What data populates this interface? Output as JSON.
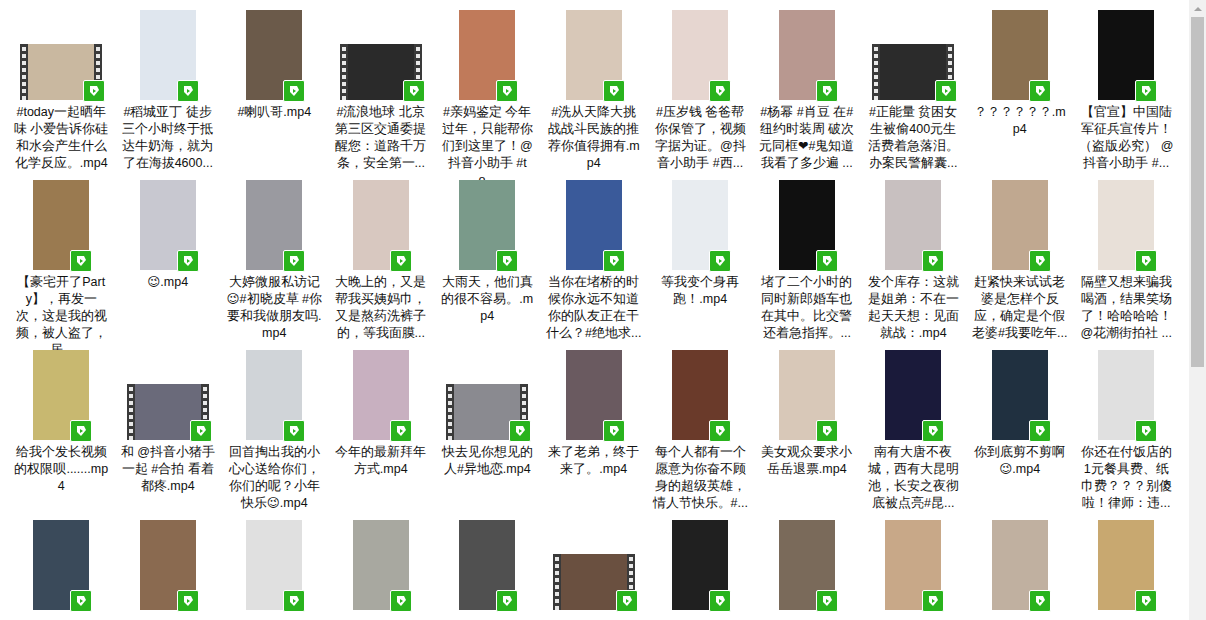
{
  "files": [
    {
      "caption": "#today一起晒年味  小爱告诉你硅和水会产生什么化学反应。.mp4",
      "kind": "film",
      "color": "#c9b8a0"
    },
    {
      "caption": "#稻城亚丁 徒步三个小时终于抵达牛奶海，就为了在海拔4600...",
      "kind": "portrait",
      "color": "#dfe6ee"
    },
    {
      "caption": "#喇叭哥.mp4",
      "kind": "portrait",
      "color": "#6b5a4a"
    },
    {
      "caption": "#流浪地球 北京第三区交通委提醒您：道路千万条，安全第一...",
      "kind": "film",
      "color": "#2a2a2a"
    },
    {
      "caption": "#亲妈鉴定 今年过年，只能帮你们到这里了！@抖音小助手 #to...",
      "kind": "portrait",
      "color": "#c07a5a"
    },
    {
      "caption": "#洗从天降大挑战战斗民族的推荐你值得拥有.mp4",
      "kind": "portrait",
      "color": "#d8c8b8"
    },
    {
      "caption": "#压岁钱 爸爸帮你保管了，视频字据为证。@抖音小助手 #西...",
      "kind": "portrait",
      "color": "#e6d6d0"
    },
    {
      "caption": "#杨幂 #肖豆 在#纽约时装周 破次元同框❤#鬼知道我看了多少遍 ...",
      "kind": "portrait",
      "color": "#b89890"
    },
    {
      "caption": "#正能量 贫困女生被偷400元生活费着急落泪。办案民警解囊...",
      "kind": "film",
      "color": "#2b2b2b"
    },
    {
      "caption": "？？？？？？.mp4",
      "kind": "portrait",
      "color": "#8a7050"
    },
    {
      "caption": "【官宣】中国陆军征兵宣传片！（盗版必究） @抖音小助手 #...",
      "kind": "portrait",
      "color": "#101010"
    },
    {
      "caption": "【豪宅开了Party】，再发一次，这是我的视频，被人盗了，居...",
      "kind": "portrait",
      "color": "#9a7a50"
    },
    {
      "caption": "😉.mp4",
      "kind": "portrait",
      "color": "#c8c8d0"
    },
    {
      "caption": "大婷微服私访记😉#初晓皮草 #你要和我做朋友吗.mp4",
      "kind": "portrait",
      "color": "#9a9aa0"
    },
    {
      "caption": "大晚上的，又是帮我买姨妈巾，又是熬药洗裤子的，等我面膜...",
      "kind": "portrait",
      "color": "#d8c8c0"
    },
    {
      "caption": "大雨天，他们真的很不容易。.mp4",
      "kind": "portrait",
      "color": "#7a9a8a"
    },
    {
      "caption": "当你在堵桥的时候你永远不知道你的队友正在干什么？#绝地求...",
      "kind": "portrait",
      "color": "#3a5a9a"
    },
    {
      "caption": "等我变个身再跑！.mp4",
      "kind": "portrait",
      "color": "#e8ecf0"
    },
    {
      "caption": "堵了二个小时的同时新郎婚车也在其中。比交警还着急指挥。...",
      "kind": "portrait",
      "color": "#101010"
    },
    {
      "caption": "发个库存：这就是姐弟：不在一起天天想：见面就战：.mp4",
      "kind": "portrait",
      "color": "#c8c0c0"
    },
    {
      "caption": "赶紧快来试试老婆是怎样个反应，确定是个假老婆#我要吃年...",
      "kind": "portrait",
      "color": "#c0a890"
    },
    {
      "caption": "隔壁又想来骗我喝酒，结果笑场了！哈哈哈哈！@花潮街拍社 ...",
      "kind": "portrait",
      "color": "#e8e0d8"
    },
    {
      "caption": "给我个发长视频的权限呗.......mp4",
      "kind": "portrait",
      "color": "#c8b870"
    },
    {
      "caption": "和 @抖音小猪手 一起 #合拍 看着都疼.mp4",
      "kind": "film",
      "color": "#6a6a7a"
    },
    {
      "caption": "回首掏出我的小心心送给你们，你们的呢？小年快乐😉.mp4",
      "kind": "portrait",
      "color": "#d0d4d8"
    },
    {
      "caption": "今年的最新拜年方式.mp4",
      "kind": "portrait",
      "color": "#c8b0c0"
    },
    {
      "caption": "快去见你想见的人#异地恋.mp4",
      "kind": "film",
      "color": "#8a8a90"
    },
    {
      "caption": "来了老弟，终于来了。.mp4",
      "kind": "portrait",
      "color": "#6a5a60"
    },
    {
      "caption": "每个人都有一个愿意为你奋不顾身的超级英雄，情人节快乐。#...",
      "kind": "portrait",
      "color": "#6a3a2a"
    },
    {
      "caption": "美女观众要求小岳岳退票.mp4",
      "kind": "portrait",
      "color": "#d8c8b8"
    },
    {
      "caption": "南有大唐不夜城，西有大昆明池，长安之夜彻底被点亮#昆...",
      "kind": "portrait",
      "color": "#1a1a3a"
    },
    {
      "caption": "你到底剪不剪啊😉.mp4",
      "kind": "portrait",
      "color": "#203040"
    },
    {
      "caption": "你还在付饭店的1元餐具费、纸巾费？？？别傻啦！律师：违...",
      "kind": "portrait",
      "color": "#e0e0e0"
    },
    {
      "kind": "portrait",
      "color": "#3a4a5a"
    },
    {
      "kind": "portrait",
      "color": "#8a6a50"
    },
    {
      "kind": "portrait",
      "color": "#e0e0e0"
    },
    {
      "kind": "portrait",
      "color": "#a8a8a0"
    },
    {
      "kind": "portrait",
      "color": "#505050"
    },
    {
      "kind": "film",
      "color": "#6a5040"
    },
    {
      "kind": "portrait",
      "color": "#202020"
    },
    {
      "kind": "portrait",
      "color": "#7a6a5a"
    },
    {
      "kind": "portrait",
      "color": "#c8a888"
    },
    {
      "kind": "portrait",
      "color": "#c0b0a0"
    },
    {
      "kind": "portrait",
      "color": "#c8a870"
    }
  ],
  "scrollbar": {
    "level": 0.58
  }
}
